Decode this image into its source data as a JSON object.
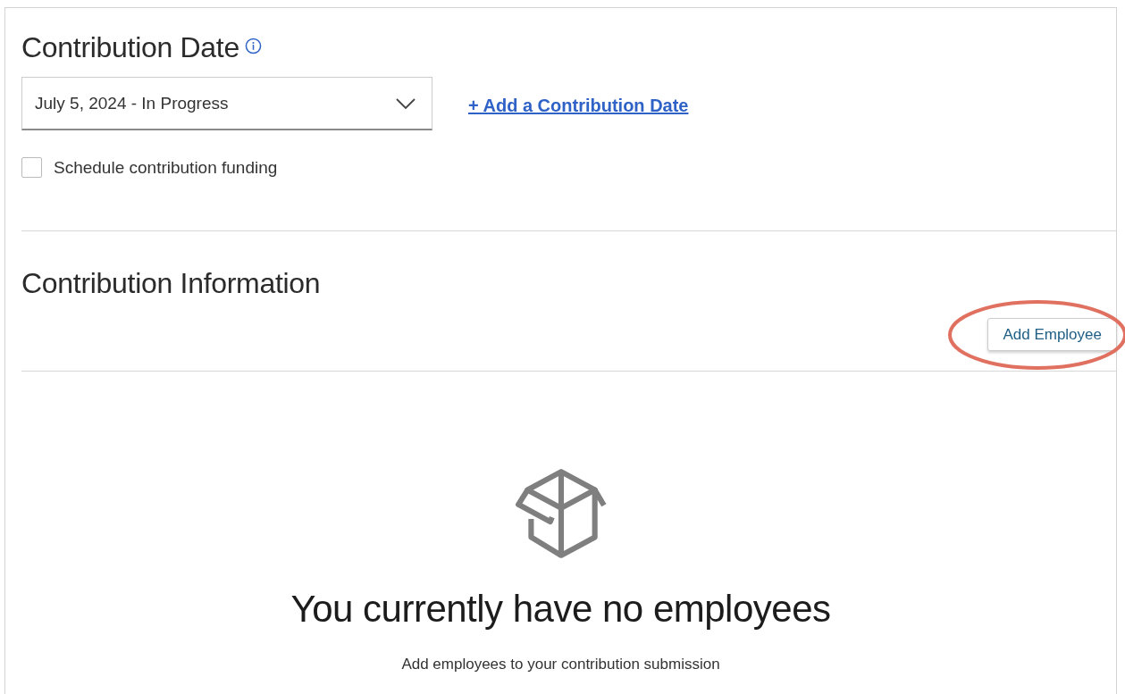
{
  "date_section": {
    "title": "Contribution Date",
    "date_select": {
      "value": "July 5, 2024 - In Progress"
    },
    "add_date_link": "+ Add a Contribution Date",
    "schedule_funding": {
      "label": "Schedule contribution funding",
      "checked": false
    }
  },
  "info_section": {
    "title": "Contribution Information",
    "add_button": {
      "label": "Add Employee",
      "highlighted": true
    }
  },
  "empty_state": {
    "heading": "You currently have no employees",
    "message": "Add employees to your contribution submission"
  }
}
